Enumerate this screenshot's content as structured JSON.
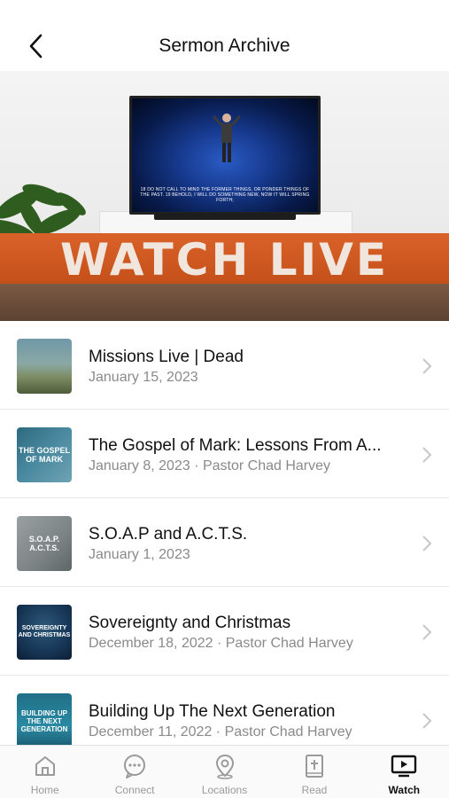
{
  "header": {
    "title": "Sermon Archive"
  },
  "hero": {
    "banner_text": "WATCH LIVE",
    "tv_caption": "18 DO NOT CALL TO MIND THE FORMER THINGS, OR PONDER THINGS OF THE PAST. 19 BEHOLD, I WILL DO SOMETHING NEW, NOW IT WILL SPRING FORTH;"
  },
  "sermons": [
    {
      "title": "Missions Live | Dead",
      "subtitle": "January 15, 2023",
      "thumb_text": ""
    },
    {
      "title": "The Gospel of Mark: Lessons From A...",
      "subtitle": "January 8, 2023 · Pastor Chad Harvey",
      "thumb_text": "THE GOSPEL OF MARK"
    },
    {
      "title": "S.O.A.P and A.C.T.S.",
      "subtitle": "January 1, 2023",
      "thumb_text": "S.O.A.P. A.C.T.S."
    },
    {
      "title": "Sovereignty and Christmas",
      "subtitle": "December 18, 2022 · Pastor Chad Harvey",
      "thumb_text": "SOVEREIGNTY AND CHRISTMAS"
    },
    {
      "title": "Building Up The Next Generation",
      "subtitle": "December 11, 2022 · Pastor Chad Harvey",
      "thumb_text": "BUILDING UP THE NEXT GENERATION"
    }
  ],
  "tabs": [
    {
      "label": "Home",
      "icon": "home-icon"
    },
    {
      "label": "Connect",
      "icon": "chat-icon"
    },
    {
      "label": "Locations",
      "icon": "location-pin-icon"
    },
    {
      "label": "Read",
      "icon": "bible-icon"
    },
    {
      "label": "Watch",
      "icon": "tv-play-icon",
      "active": true
    }
  ],
  "colors": {
    "banner": "#c85420",
    "accent": "#111111",
    "muted": "#8a8a8a"
  }
}
